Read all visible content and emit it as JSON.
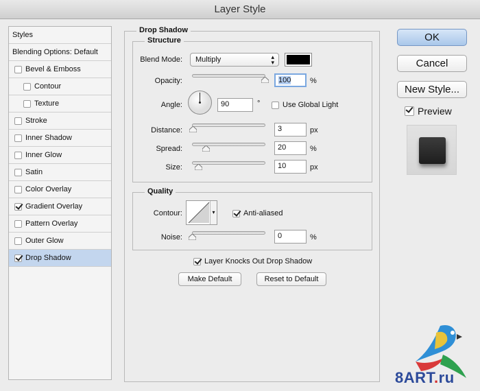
{
  "window": {
    "title": "Layer Style"
  },
  "styles_list": {
    "header": "Styles",
    "blending": "Blending Options: Default",
    "items": [
      {
        "label": "Bevel & Emboss",
        "checked": false,
        "indent": false
      },
      {
        "label": "Contour",
        "checked": false,
        "indent": true
      },
      {
        "label": "Texture",
        "checked": false,
        "indent": true
      },
      {
        "label": "Stroke",
        "checked": false,
        "indent": false
      },
      {
        "label": "Inner Shadow",
        "checked": false,
        "indent": false
      },
      {
        "label": "Inner Glow",
        "checked": false,
        "indent": false
      },
      {
        "label": "Satin",
        "checked": false,
        "indent": false
      },
      {
        "label": "Color Overlay",
        "checked": false,
        "indent": false
      },
      {
        "label": "Gradient Overlay",
        "checked": true,
        "indent": false
      },
      {
        "label": "Pattern Overlay",
        "checked": false,
        "indent": false
      },
      {
        "label": "Outer Glow",
        "checked": false,
        "indent": false
      },
      {
        "label": "Drop Shadow",
        "checked": true,
        "indent": false,
        "selected": true
      }
    ]
  },
  "drop_shadow": {
    "title": "Drop Shadow",
    "structure": {
      "title": "Structure",
      "blend_mode_label": "Blend Mode:",
      "blend_mode_value": "Multiply",
      "shadow_color": "#000000",
      "opacity_label": "Opacity:",
      "opacity_value": "100",
      "opacity_unit": "%",
      "opacity_fraction": 1.0,
      "angle_label": "Angle:",
      "angle_value": "90",
      "angle_unit": "°",
      "use_global_light_label": "Use Global Light",
      "use_global_light": false,
      "distance_label": "Distance:",
      "distance_value": "3",
      "distance_unit": "px",
      "distance_fraction": 0.01,
      "spread_label": "Spread:",
      "spread_value": "20",
      "spread_unit": "%",
      "spread_fraction": 0.2,
      "size_label": "Size:",
      "size_value": "10",
      "size_unit": "px",
      "size_fraction": 0.04
    },
    "quality": {
      "title": "Quality",
      "contour_label": "Contour:",
      "anti_aliased_label": "Anti-aliased",
      "anti_aliased": true,
      "noise_label": "Noise:",
      "noise_value": "0",
      "noise_unit": "%",
      "noise_fraction": 0.0
    },
    "knocks_out_label": "Layer Knocks Out Drop Shadow",
    "knocks_out": true,
    "make_default_label": "Make Default",
    "reset_default_label": "Reset to Default"
  },
  "buttons": {
    "ok": "OK",
    "cancel": "Cancel",
    "new_style": "New Style...",
    "preview_label": "Preview",
    "preview_checked": true
  },
  "watermark": {
    "text_main": "8ART",
    "text_dot": ".",
    "text_tld": "ru"
  },
  "colors": {
    "accent": "#c3d6ee",
    "default_button": "#a9c7ea"
  }
}
